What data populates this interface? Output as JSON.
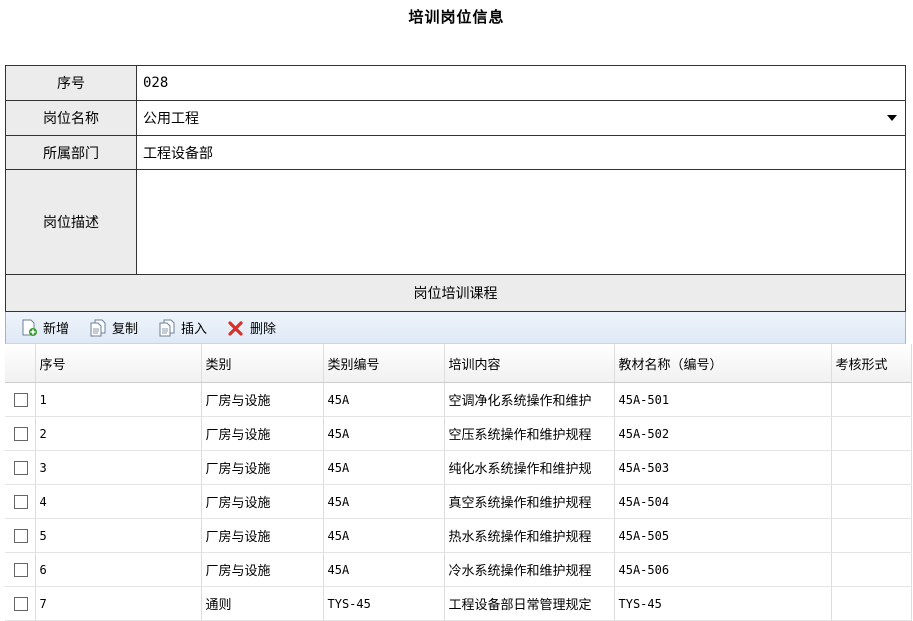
{
  "title": "培训岗位信息",
  "form": {
    "seq_label": "序号",
    "seq_value": "028",
    "position_label": "岗位名称",
    "position_value": "公用工程",
    "dept_label": "所属部门",
    "dept_value": "工程设备部",
    "desc_label": "岗位描述",
    "desc_value": "",
    "section_title": "岗位培训课程"
  },
  "toolbar": {
    "add": "新增",
    "copy": "复制",
    "insert": "插入",
    "delete": "删除"
  },
  "grid": {
    "headers": [
      "序号",
      "类别",
      "类别编号",
      "培训内容",
      "教材名称（编号）",
      "考核形式"
    ],
    "rows": [
      [
        "1",
        "厂房与设施",
        "45A",
        "空调净化系统操作和维护",
        "45A-501",
        ""
      ],
      [
        "2",
        "厂房与设施",
        "45A",
        "空压系统操作和维护规程",
        "45A-502",
        ""
      ],
      [
        "3",
        "厂房与设施",
        "45A",
        "纯化水系统操作和维护规",
        "45A-503",
        ""
      ],
      [
        "4",
        "厂房与设施",
        "45A",
        "真空系统操作和维护规程",
        "45A-504",
        ""
      ],
      [
        "5",
        "厂房与设施",
        "45A",
        "热水系统操作和维护规程",
        "45A-505",
        ""
      ],
      [
        "6",
        "厂房与设施",
        "45A",
        "冷水系统操作和维护规程",
        "45A-506",
        ""
      ],
      [
        "7",
        "通则",
        "TYS-45",
        "工程设备部日常管理规定",
        "TYS-45",
        ""
      ]
    ]
  },
  "colors": {
    "label_bg": "#ececec",
    "toolbar_bg": "#e6eef8",
    "delete_red": "#d9302a",
    "add_green": "#3a9a2e"
  },
  "icons": [
    "new-doc-icon",
    "copy-doc-icon",
    "insert-doc-icon",
    "delete-x-icon"
  ]
}
